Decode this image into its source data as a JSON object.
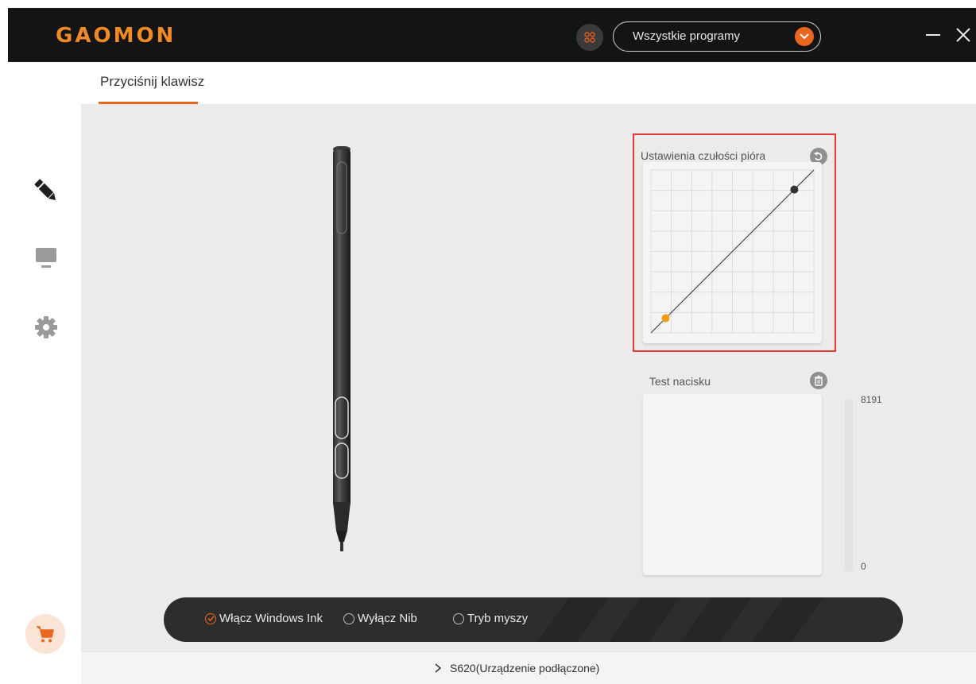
{
  "header": {
    "logo_text": "GAOMON",
    "program_select": {
      "selected": "Wszystkie programy"
    }
  },
  "tabs": [
    {
      "label": "Przyciśnij klawisz",
      "active": true
    }
  ],
  "sidebar": {
    "items": [
      {
        "icon": "pen-icon",
        "active": true
      },
      {
        "icon": "monitor-icon",
        "active": false
      },
      {
        "icon": "gear-icon",
        "active": false
      }
    ],
    "cart_icon": "cart-icon"
  },
  "pressure_curve": {
    "title": "Ustawienia czułości pióra",
    "reset_icon": "undo-icon",
    "min_point": [
      0.09,
      0.09
    ],
    "max_point": [
      0.88,
      0.88
    ]
  },
  "pressure_test": {
    "title": "Test nacisku",
    "clear_icon": "trash-icon",
    "max_label": "8191",
    "min_label": "0",
    "level": 0
  },
  "options": [
    {
      "label": "Włącz Windows Ink",
      "checked": true
    },
    {
      "label": "Wyłącz Nib",
      "checked": false
    },
    {
      "label": "Tryb myszy",
      "checked": false
    }
  ],
  "footer": {
    "device_status": "S620(Urządzenie podłączone)"
  },
  "colors": {
    "accent": "#e8661e",
    "titlebar": "#141414",
    "highlight": "#e53935"
  }
}
